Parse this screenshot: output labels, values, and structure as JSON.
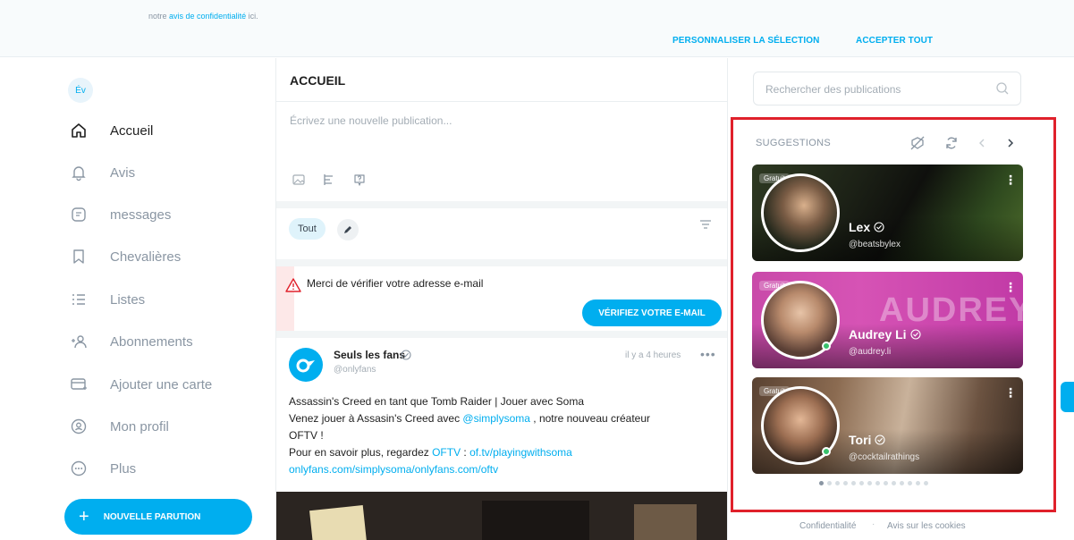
{
  "cookie_banner": {
    "text_prefix": "notre",
    "link": "avis de confidentialité",
    "text_suffix": "ici.",
    "customize_label": "PERSONNALISER LA SÉLECTION",
    "accept_label": "ACCEPTER TOUT"
  },
  "sidebar": {
    "avatar_initials": "Év",
    "items": [
      {
        "label": "Accueil",
        "icon": "home-icon",
        "active": true
      },
      {
        "label": "Avis",
        "icon": "bell-icon",
        "active": false
      },
      {
        "label": "messages",
        "icon": "message-icon",
        "active": false
      },
      {
        "label": "Chevalières",
        "icon": "bookmark-icon",
        "active": false
      },
      {
        "label": "Listes",
        "icon": "list-icon",
        "active": false
      },
      {
        "label": "Abonnements",
        "icon": "subscriptions-icon",
        "active": false
      },
      {
        "label": "Ajouter une carte",
        "icon": "card-icon",
        "active": false
      },
      {
        "label": "Mon profil",
        "icon": "profile-icon",
        "active": false
      },
      {
        "label": "Plus",
        "icon": "more-icon",
        "active": false
      }
    ],
    "new_post_label": "NOUVELLE PARUTION"
  },
  "feed": {
    "title": "ACCUEIL",
    "compose_placeholder": "Écrivez une nouvelle publication...",
    "filter_chip": "Tout",
    "verify": {
      "message": "Merci de vérifier votre adresse e-mail",
      "button": "VÉRIFIEZ VOTRE E-MAIL"
    },
    "post": {
      "author": "Seuls les fans",
      "handle": "@onlyfans",
      "time": "il y a 4 heures",
      "line1": "Assassin's Creed en tant que Tomb Raider | Jouer avec Soma",
      "line2_prefix": "Venez jouer à Assasin's Creed avec ",
      "line2_link": "@simplysoma",
      "line2_suffix": " , notre nouveau créateur",
      "line3": "OFTV !",
      "line4_prefix": "Pour en savoir plus, regardez ",
      "line4_link1": "OFTV",
      "line4_sep": " : ",
      "line4_link2": "of.tv/playingwithsoma",
      "line5_link": "onlyfans.com/simplysoma/onlyfans.com/oftv"
    }
  },
  "right": {
    "search_placeholder": "Rechercher des publications",
    "suggestions": {
      "title": "SUGGESTIONS",
      "cards": [
        {
          "badge": "Gratuit",
          "name": "Lex",
          "handle": "@beatsbylex"
        },
        {
          "badge": "Gratuit",
          "name": "Audrey Li",
          "handle": "@audrey.li"
        },
        {
          "badge": "Gratuit",
          "name": "Tori",
          "handle": "@cocktailrathings"
        }
      ],
      "banner_text": "AUDREY",
      "page_count": 14,
      "current_page": 1
    },
    "footer": {
      "privacy": "Confidentialité",
      "separator": "·",
      "cookies": "Avis sur les cookies"
    }
  },
  "colors": {
    "accent": "#00aeef",
    "highlight_box": "#e0212b",
    "online": "#39c16c"
  }
}
